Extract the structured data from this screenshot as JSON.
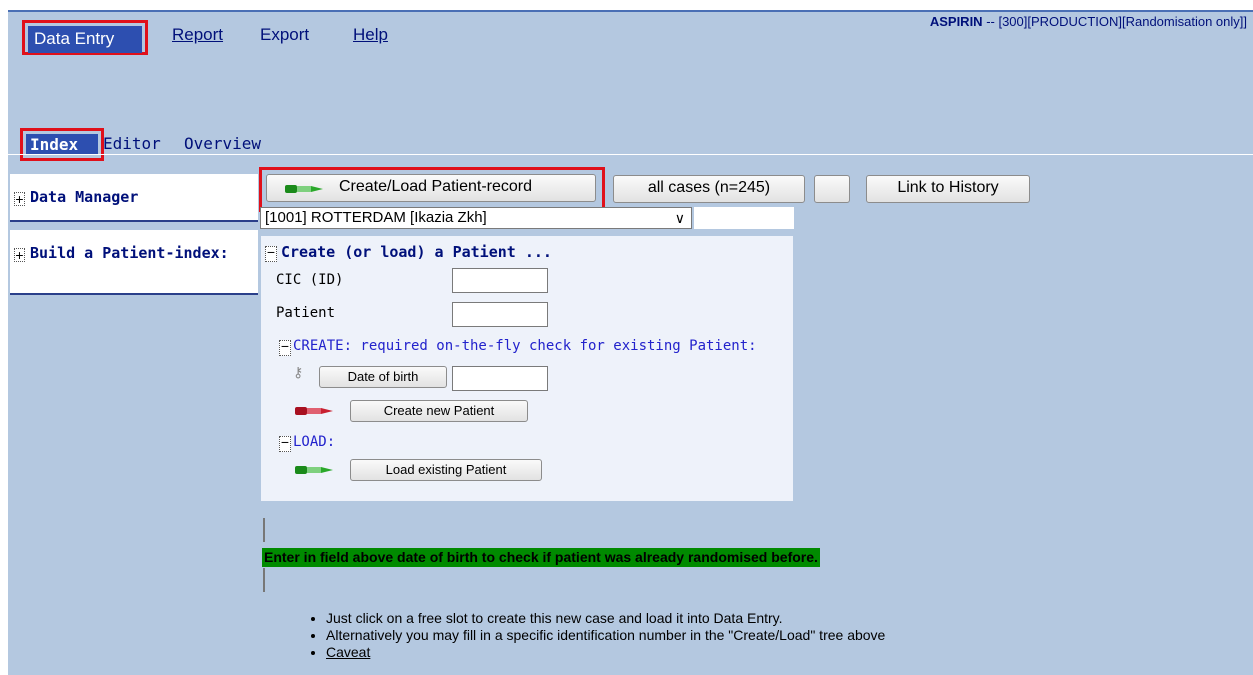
{
  "menu": {
    "data_entry": "Data Entry",
    "report": "Report",
    "export": "Export",
    "help": "Help"
  },
  "title": {
    "app": "ASPIRIN",
    "rest": " -- [300][PRODUCTION][Randomisation only]]"
  },
  "subtabs": {
    "index": "Index",
    "editor": "Editor",
    "overview": "Overview"
  },
  "sidebar": {
    "items": [
      {
        "toggle": "+",
        "label": "Data Manager"
      },
      {
        "toggle": "+",
        "label": "Build a Patient-index:"
      }
    ]
  },
  "toolbar": {
    "create_load": "Create/Load Patient-record",
    "all_cases": "all cases (n=245)",
    "blank": "",
    "link_history": "Link to History"
  },
  "site_select": {
    "value": "[1001] ROTTERDAM [Ikazia Zkh]"
  },
  "create_panel": {
    "toggle": "−",
    "heading": "Create (or load) a Patient ...",
    "cic_label": "CIC (ID)",
    "cic_value": "",
    "patient_label": "Patient",
    "patient_value": "",
    "create_section": {
      "toggle": "−",
      "label": "CREATE: required on-the-fly check for existing Patient:",
      "dob_button": "Date of birth",
      "dob_value": "",
      "create_button": "Create new Patient"
    },
    "load_section": {
      "toggle": "−",
      "label": "LOAD:",
      "load_button": "Load existing Patient"
    }
  },
  "message": "Enter in field above date of birth to check if patient was already randomised before.",
  "notes": [
    "Just click on a free slot to create this new case and load it into Data Entry.",
    "Alternatively you may fill in a specific identification number in the \"Create/Load\" tree above",
    "Caveat"
  ],
  "colors": {
    "background": "#b4c8e0",
    "highlight_border": "#e0101a",
    "active_tab": "#2d4fb0",
    "message_bg": "#008a00"
  }
}
